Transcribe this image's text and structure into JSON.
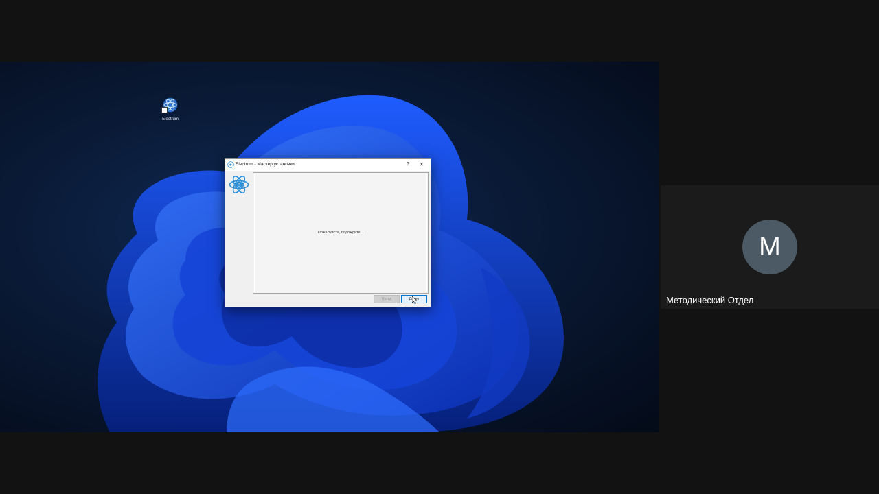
{
  "desktop": {
    "icon_label": "Electrum"
  },
  "dialog": {
    "title": "Electrum  -  Мастер установки",
    "help_label": "?",
    "close_label": "✕",
    "status_text": "Пожалуйста, подождите...",
    "back_label": "Назад",
    "next_label": "Далее",
    "icons": [
      "electrum-logo-icon",
      "question-icon",
      "close-icon",
      "cursor-icon"
    ]
  },
  "participant": {
    "initial": "M",
    "name": "Методический Отдел",
    "avatar_color": "#4b5a64"
  },
  "colors": {
    "accent": "#0078d7",
    "electrum_blue": "#2a8fd6"
  }
}
